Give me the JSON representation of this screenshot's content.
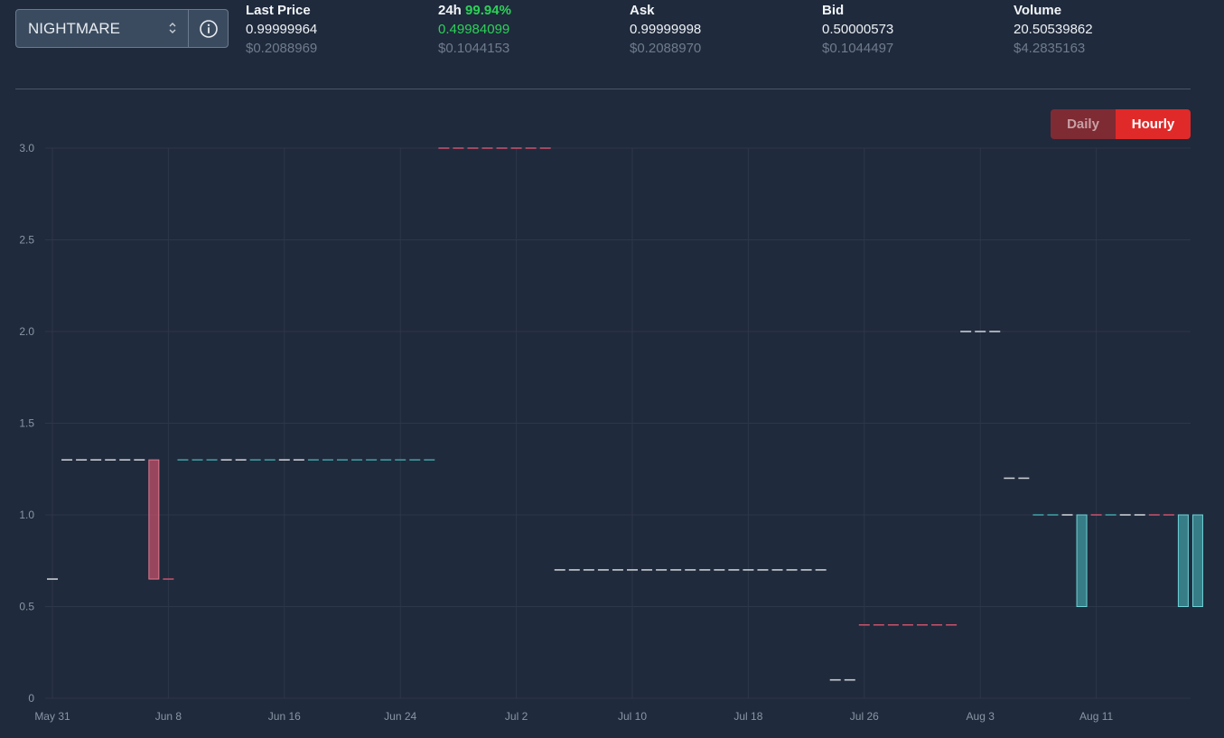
{
  "market": {
    "selected": "NIGHTMARE",
    "info_icon": "info-icon",
    "chevron_icon": "chevron-updown-icon"
  },
  "stats": [
    {
      "label": "Last Price",
      "value": "0.99999964",
      "usd": "$0.2088969"
    },
    {
      "label": "24h",
      "pct": "99.94%",
      "value": "0.49984099",
      "usd": "$0.1044153"
    },
    {
      "label": "Ask",
      "value": "0.99999998",
      "usd": "$0.2088970"
    },
    {
      "label": "Bid",
      "value": "0.50000573",
      "usd": "$0.1044497"
    },
    {
      "label": "Volume",
      "value": "20.50539862",
      "usd": "$4.2835163"
    }
  ],
  "toggle": {
    "daily": "Daily",
    "hourly": "Hourly",
    "active": "Hourly"
  },
  "colors": {
    "up": "#3f9aa0",
    "down": "#c0506a",
    "neutral": "#c8ccd2",
    "grid": "#2c3749",
    "accent": "#e02a2a",
    "green": "#2ed158"
  },
  "chart_data": {
    "type": "candlestick",
    "x_start": "2023-05-31",
    "x_end": "2023-08-17",
    "xticks": [
      {
        "date": "2023-05-31",
        "label": "May 31"
      },
      {
        "date": "2023-06-08",
        "label": "Jun 8"
      },
      {
        "date": "2023-06-16",
        "label": "Jun 16"
      },
      {
        "date": "2023-06-24",
        "label": "Jun 24"
      },
      {
        "date": "2023-07-02",
        "label": "Jul 2"
      },
      {
        "date": "2023-07-10",
        "label": "Jul 10"
      },
      {
        "date": "2023-07-18",
        "label": "Jul 18"
      },
      {
        "date": "2023-07-26",
        "label": "Jul 26"
      },
      {
        "date": "2023-08-03",
        "label": "Aug 3"
      },
      {
        "date": "2023-08-11",
        "label": "Aug 11"
      }
    ],
    "yticks": [
      0,
      0.5,
      1.0,
      1.5,
      2.0,
      2.5,
      3.0
    ],
    "ylim": [
      0,
      3.0
    ],
    "grid": true,
    "flats": [
      {
        "start": "2023-05-31",
        "end": "2023-05-31",
        "value": 0.65,
        "color": "neutral"
      },
      {
        "start": "2023-06-01",
        "end": "2023-06-06",
        "value": 1.3,
        "color": "neutral"
      },
      {
        "start": "2023-06-08",
        "end": "2023-06-08",
        "value": 0.65,
        "color": "down"
      },
      {
        "start": "2023-06-09",
        "end": "2023-06-11",
        "value": 1.3,
        "color": "up"
      },
      {
        "start": "2023-06-12",
        "end": "2023-06-13",
        "value": 1.3,
        "color": "neutral"
      },
      {
        "start": "2023-06-14",
        "end": "2023-06-15",
        "value": 1.3,
        "color": "up"
      },
      {
        "start": "2023-06-16",
        "end": "2023-06-17",
        "value": 1.3,
        "color": "neutral"
      },
      {
        "start": "2023-06-18",
        "end": "2023-06-26",
        "value": 1.3,
        "color": "up"
      },
      {
        "start": "2023-06-27",
        "end": "2023-07-04",
        "value": 3.0,
        "color": "down"
      },
      {
        "start": "2023-07-05",
        "end": "2023-07-23",
        "value": 0.7,
        "color": "neutral"
      },
      {
        "start": "2023-07-24",
        "end": "2023-07-25",
        "value": 0.1,
        "color": "neutral"
      },
      {
        "start": "2023-07-26",
        "end": "2023-08-01",
        "value": 0.4,
        "color": "down"
      },
      {
        "start": "2023-08-02",
        "end": "2023-08-04",
        "value": 2.0,
        "color": "neutral"
      },
      {
        "start": "2023-08-05",
        "end": "2023-08-06",
        "value": 1.2,
        "color": "neutral"
      },
      {
        "start": "2023-08-07",
        "end": "2023-08-08",
        "value": 1.0,
        "color": "up"
      },
      {
        "start": "2023-08-09",
        "end": "2023-08-09",
        "value": 1.0,
        "color": "neutral"
      },
      {
        "start": "2023-08-11",
        "end": "2023-08-11",
        "value": 1.0,
        "color": "down"
      },
      {
        "start": "2023-08-12",
        "end": "2023-08-12",
        "value": 1.0,
        "color": "up"
      },
      {
        "start": "2023-08-13",
        "end": "2023-08-14",
        "value": 1.0,
        "color": "neutral"
      },
      {
        "start": "2023-08-15",
        "end": "2023-08-16",
        "value": 1.0,
        "color": "down"
      }
    ],
    "candles": [
      {
        "date": "2023-06-07",
        "open": 1.3,
        "close": 0.65,
        "color": "down"
      },
      {
        "date": "2023-08-10",
        "open": 0.5,
        "close": 1.0,
        "color": "up"
      },
      {
        "date": "2023-08-17",
        "open": 0.5,
        "close": 1.0,
        "color": "up"
      },
      {
        "date": "2023-08-18",
        "open": 0.5,
        "close": 1.0,
        "color": "up"
      }
    ]
  }
}
